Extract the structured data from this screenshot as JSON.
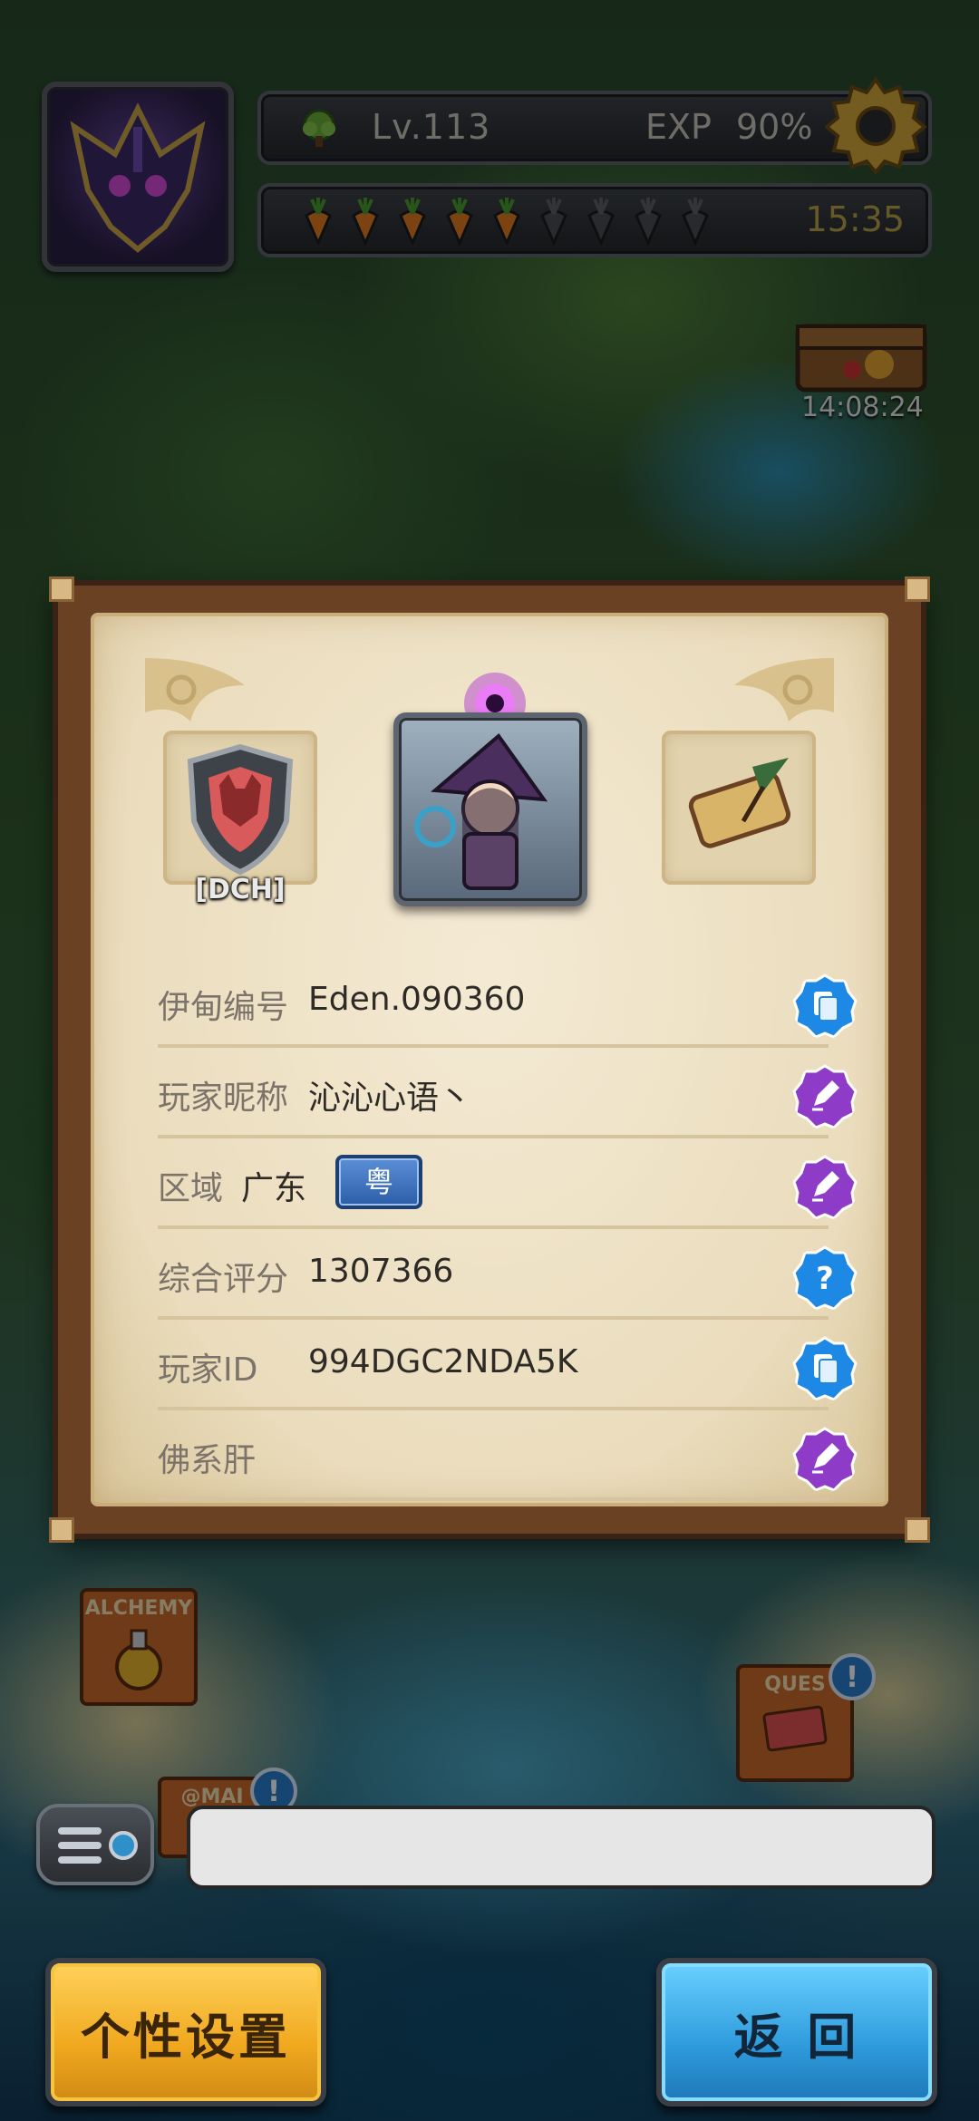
{
  "hud": {
    "level_text": "Lv.113",
    "exp_label": "EXP",
    "exp_value": "90%",
    "energy_time": "15:35",
    "energy_filled": 5,
    "energy_total": 9,
    "chest_timer": "14:08:24"
  },
  "map_signs": {
    "alchemy": "ALCHEMY",
    "quest": "QUES",
    "mail": "@MAI"
  },
  "profile": {
    "guild_tag": "[DCH]",
    "rows": [
      {
        "label": "伊甸编号",
        "value": "Eden.090360",
        "action": "copy"
      },
      {
        "label": "玩家昵称",
        "value": "沁沁心语丶",
        "action": "edit"
      },
      {
        "label": "区域",
        "value": "广东",
        "badge": "粤",
        "action": "edit"
      },
      {
        "label": "综合评分",
        "value": "1307366",
        "action": "help"
      },
      {
        "label": "玩家ID",
        "value": "994DGC2NDA5K",
        "action": "copy"
      },
      {
        "label": "佛系肝",
        "value": "",
        "action": "edit"
      }
    ]
  },
  "buttons": {
    "settings": "个性设置",
    "back": "返 回"
  },
  "colors": {
    "copy": "#1e88e5",
    "edit": "#8e3cc8",
    "help": "#1e88e5",
    "gold": "#f0a81f",
    "blue": "#2e9bdc"
  }
}
